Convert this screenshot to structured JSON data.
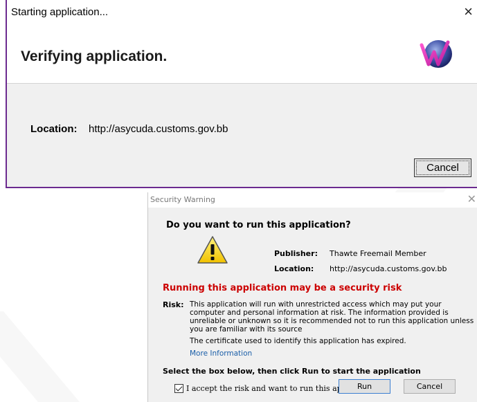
{
  "starting_dialog": {
    "title": "Starting application...",
    "close_glyph": "×",
    "heading": "Verifying application.",
    "logo_icon": "webstart-w-icon",
    "location_label": "Location:",
    "location_value": "http://asycuda.customs.gov.bb",
    "cancel_label": "Cancel",
    "accent_color": "#6b2a8f"
  },
  "security_dialog": {
    "title": "Security Warning",
    "close_glyph": "✕",
    "question": "Do you want to run this application?",
    "warning_icon": "warning-triangle-icon",
    "publisher_label": "Publisher:",
    "publisher_value": "Thawte Freemail Member",
    "location_label": "Location:",
    "location_value": "http://asycuda.customs.gov.bb",
    "risk_heading": "Running this application may be a security risk",
    "risk_heading_color": "#cc0000",
    "risk_label": "Risk:",
    "risk_text": "This application will run with unrestricted access which may put your computer and personal information at risk. The information provided is unreliable or unknown so it is recommended not to run this application unless you are familiar with its source",
    "certificate_text": "The certificate used to identify this application has expired.",
    "more_info_label": "More Information",
    "select_instruction": "Select the box below, then click Run to start the application",
    "accept_label": "I accept the risk and want to run this application.",
    "accept_checked": true,
    "run_label": "Run",
    "cancel_label": "Cancel"
  }
}
